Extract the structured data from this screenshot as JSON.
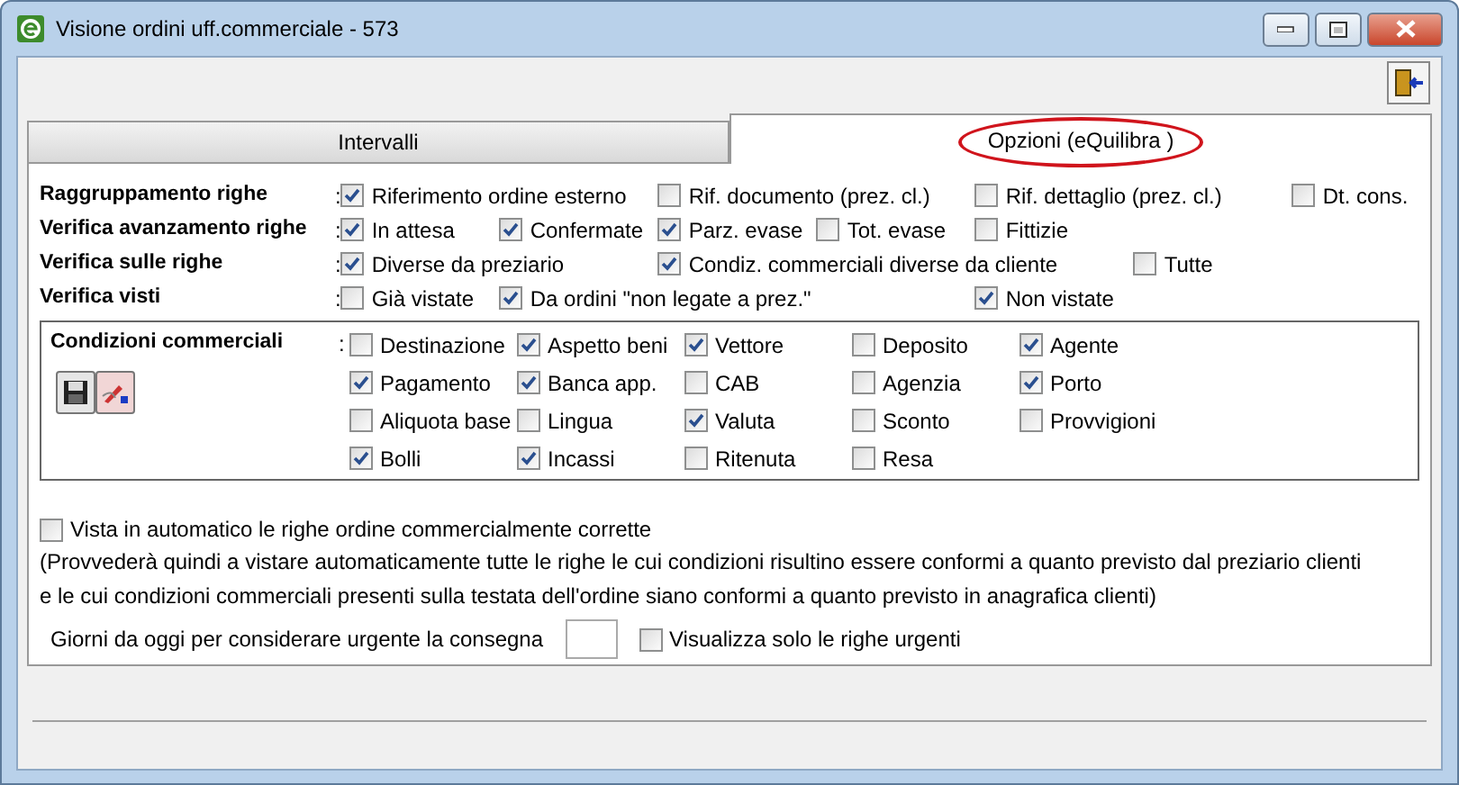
{
  "window": {
    "title": "Visione ordini uff.commerciale - 573"
  },
  "tabs": [
    {
      "label": "Intervalli",
      "selected": false
    },
    {
      "label": "Opzioni (eQuilibra )",
      "selected": true,
      "highlighted": true
    }
  ],
  "option_rows": [
    {
      "label": "Raggruppamento righe",
      "separator": ":",
      "options": [
        {
          "label": "Riferimento ordine esterno",
          "checked": true
        },
        {
          "label": "Rif. documento (prez. cl.)",
          "checked": false
        },
        {
          "label": "Rif. dettaglio (prez. cl.)",
          "checked": false
        },
        {
          "label": "Dt. cons.",
          "checked": false
        }
      ]
    },
    {
      "label": "Verifica avanzamento righe",
      "separator": ":",
      "options": [
        {
          "label": "In attesa",
          "checked": true
        },
        {
          "label": "Confermate",
          "checked": true
        },
        {
          "label": "Parz. evase",
          "checked": true
        },
        {
          "label": "Tot. evase",
          "checked": false
        },
        {
          "label": "Fittizie",
          "checked": false
        }
      ]
    },
    {
      "label": "Verifica sulle righe",
      "separator": ":",
      "options": [
        {
          "label": "Diverse da preziario",
          "checked": true
        },
        {
          "label": "Condiz. commerciali diverse da cliente",
          "checked": true
        },
        {
          "label": "Tutte",
          "checked": false
        }
      ]
    },
    {
      "label": "Verifica visti",
      "separator": ":",
      "options": [
        {
          "label": "Già vistate",
          "checked": false
        },
        {
          "label": "Da ordini \"non legate a prez.\"",
          "checked": true
        },
        {
          "label": "Non vistate",
          "checked": true
        }
      ]
    }
  ],
  "conditions": {
    "label": "Condizioni commerciali",
    "separator": ":",
    "options": [
      {
        "label": "Destinazione",
        "checked": false
      },
      {
        "label": "Aspetto beni",
        "checked": true
      },
      {
        "label": "Vettore",
        "checked": true
      },
      {
        "label": "Deposito",
        "checked": false
      },
      {
        "label": "Agente",
        "checked": true
      },
      {
        "label": "Pagamento",
        "checked": true
      },
      {
        "label": "Banca app.",
        "checked": true
      },
      {
        "label": "CAB",
        "checked": false
      },
      {
        "label": "Agenzia",
        "checked": false
      },
      {
        "label": "Porto",
        "checked": true
      },
      {
        "label": "Aliquota base",
        "checked": false
      },
      {
        "label": "Lingua",
        "checked": false
      },
      {
        "label": "Valuta",
        "checked": true
      },
      {
        "label": "Sconto",
        "checked": false
      },
      {
        "label": "Provvigioni",
        "checked": false
      },
      {
        "label": "Bolli",
        "checked": true
      },
      {
        "label": "Incassi",
        "checked": true
      },
      {
        "label": "Ritenuta",
        "checked": false
      },
      {
        "label": "Resa",
        "checked": false
      }
    ]
  },
  "auto_approve": {
    "label": "Vista in automatico le righe ordine commercialmente corrette",
    "checked": false
  },
  "note": [
    "(Provvederà quindi a vistare automaticamente tutte le righe le cui condizioni risultino essere conformi a quanto previsto dal preziario clienti",
    "e le cui condizioni commerciali presenti sulla testata dell'ordine siano conformi a quanto previsto in anagrafica clienti)"
  ],
  "urgent_days": {
    "label": "Giorni da oggi per considerare urgente la consegna"
  },
  "only_urgent": {
    "label": "Visualizza solo le righe urgenti",
    "checked": false
  }
}
